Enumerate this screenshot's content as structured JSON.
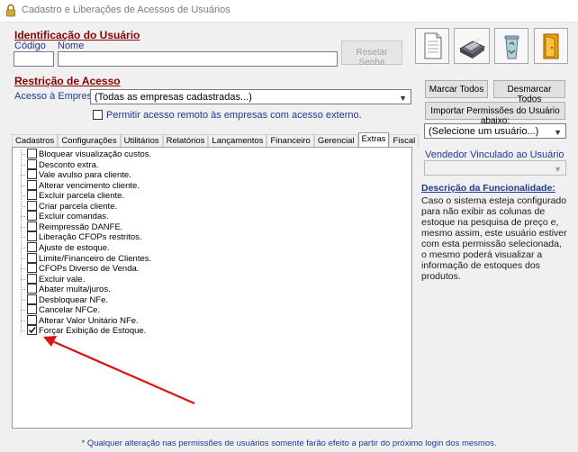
{
  "window": {
    "title": "Cadastro e Liberações de Acessos de Usuários",
    "icon": "lock-icon"
  },
  "identificacao": {
    "title": "Identificação do Usuário",
    "codigo_label": "Código",
    "nome_label": "Nome",
    "codigo_value": "",
    "nome_value": "",
    "reset_button": "Resetar Senha"
  },
  "toolbar": {
    "icons": [
      "new-document-icon",
      "save-disk-icon",
      "recycle-bin-icon",
      "exit-door-icon"
    ]
  },
  "restricao": {
    "title": "Restrição de Acesso",
    "empresa_label": "Acesso à Empresa:",
    "empresa_value": "(Todas as empresas cadastradas...)",
    "remoto_label": "Permitir acesso remoto às empresas com acesso externo.",
    "remoto_checked": false
  },
  "actions": {
    "marcar_todos": "Marcar Todos",
    "desmarcar_todos": "Desmarcar Todos",
    "importar": "Importar Permissões do Usuário abaixo:",
    "usuario_select": "(Selecione um usuário...)",
    "vendedor_label": "Vendedor Vinculado ao Usuário",
    "vendedor_value": ""
  },
  "tabs": [
    {
      "label": "Cadastros",
      "active": false
    },
    {
      "label": "Configurações",
      "active": false
    },
    {
      "label": "Utilitários",
      "active": false
    },
    {
      "label": "Relatórios",
      "active": false
    },
    {
      "label": "Lançamentos",
      "active": false
    },
    {
      "label": "Financeiro",
      "active": false
    },
    {
      "label": "Gerencial",
      "active": false
    },
    {
      "label": "Extras",
      "active": true
    },
    {
      "label": "Fiscal",
      "active": false
    }
  ],
  "permissions": [
    {
      "label": "Bloquear visualização custos.",
      "checked": false
    },
    {
      "label": "Desconto extra.",
      "checked": false
    },
    {
      "label": "Vale avulso para cliente.",
      "checked": false
    },
    {
      "label": "Alterar vencimento cliente.",
      "checked": false
    },
    {
      "label": "Excluir parcela cliente.",
      "checked": false
    },
    {
      "label": "Criar parcela cliente.",
      "checked": false
    },
    {
      "label": "Excluir comandas.",
      "checked": false
    },
    {
      "label": "Reimpressão DANFE.",
      "checked": false
    },
    {
      "label": "Liberação CFOPs restritos.",
      "checked": false
    },
    {
      "label": "Ajuste de estoque.",
      "checked": false
    },
    {
      "label": "Limite/Financeiro de Clientes.",
      "checked": false
    },
    {
      "label": "CFOPs Diverso de Venda.",
      "checked": false
    },
    {
      "label": "Excluir vale.",
      "checked": false
    },
    {
      "label": "Abater multa/juros.",
      "checked": false
    },
    {
      "label": "Desbloquear NFe.",
      "checked": false
    },
    {
      "label": "Cancelar NFCe.",
      "checked": false
    },
    {
      "label": "Alterar Valor Unitário NFe.",
      "checked": false
    },
    {
      "label": "Forçar Exibição de Estoque.",
      "checked": true
    }
  ],
  "descricao": {
    "title": "Descrição da Funcionalidade:",
    "text": "Caso o sistema esteja configurado para não exibir as colunas de estoque na pesquisa de preço e, mesmo assim, este usuário estiver com esta permissão selecionada, o mesmo poderá visualizar a informação de estoques dos produtos."
  },
  "footer": "* Qualquer alteração nas permissões de usuários somente farão efeito a partir do próximo login dos mesmos.",
  "colors": {
    "section_title": "#8b0000",
    "blue_label": "#1e3a9a",
    "arrow": "#e01010"
  }
}
